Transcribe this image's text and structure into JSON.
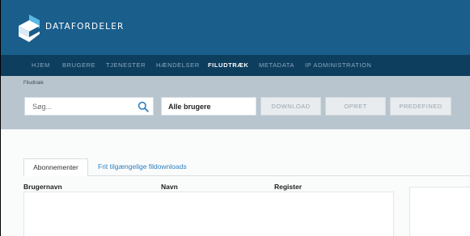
{
  "header": {
    "brand": "DATAFORDELER"
  },
  "nav": {
    "items": [
      {
        "label": "HJEM",
        "active": false
      },
      {
        "label": "BRUGERE",
        "active": false
      },
      {
        "label": "TJENESTER",
        "active": false
      },
      {
        "label": "HÆNDELSER",
        "active": false
      },
      {
        "label": "FILUDTRÆK",
        "active": true
      },
      {
        "label": "METADATA",
        "active": false
      },
      {
        "label": "IP ADMINISTRATION",
        "active": false
      }
    ]
  },
  "toolbar": {
    "breadcrumb": "Filudtræk",
    "search_placeholder": "Søg...",
    "user_filter": "Alle brugere",
    "download_label": "DOWNLOAD",
    "create_label": "OPRET",
    "predefined_label": "PREDEFINED"
  },
  "tabs": {
    "active": "Abonnementer",
    "other": "Frit tilgængelige fildownloads"
  },
  "table": {
    "columns": [
      "Brugernavn",
      "Navn",
      "Register"
    ]
  },
  "colors": {
    "header_bg": "#1a5e8c",
    "nav_bg": "#0d3e5e",
    "toolbar_bg": "#b8c5cf",
    "link": "#2d7fc1"
  }
}
